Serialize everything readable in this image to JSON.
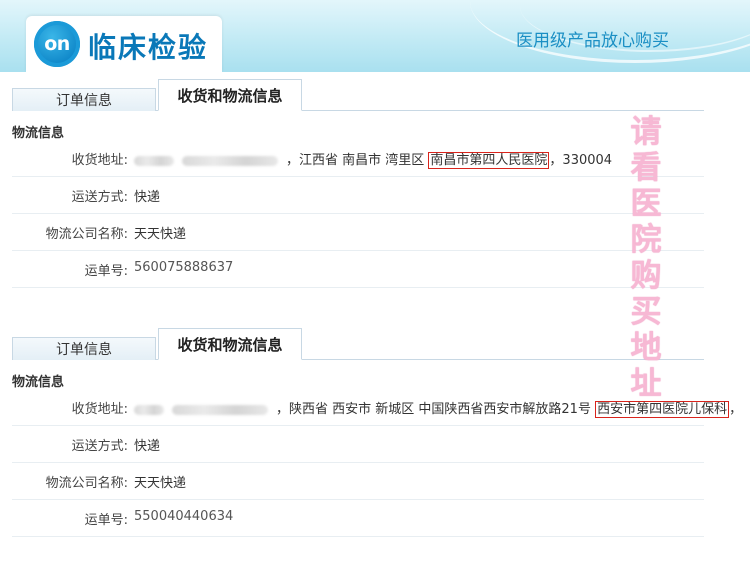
{
  "header": {
    "logo_badge": "on",
    "logo_text": "临床检验",
    "slogan": "医用级产品放心购买"
  },
  "orders": [
    {
      "tabs": {
        "inactive": "订单信息",
        "active": "收货和物流信息"
      },
      "section_title": "物流信息",
      "address_label": "收货地址:",
      "address_prefix": "，江西省 南昌市 湾里区 ",
      "address_highlight": "南昌市第四人民医院",
      "address_suffix": "，330004",
      "shipping_label": "运送方式:",
      "shipping_value": "快递",
      "courier_label": "物流公司名称:",
      "courier_value": "天天快递",
      "tracking_label": "运单号:",
      "tracking_value": "560075888637"
    },
    {
      "tabs": {
        "inactive": "订单信息",
        "active": "收货和物流信息"
      },
      "section_title": "物流信息",
      "address_label": "收货地址:",
      "address_prefix": "，陕西省 西安市 新城区 中国陕西省西安市解放路21号 ",
      "address_highlight": "西安市第四医院儿保科",
      "address_suffix": "，",
      "shipping_label": "运送方式:",
      "shipping_value": "快递",
      "courier_label": "物流公司名称:",
      "courier_value": "天天快递",
      "tracking_label": "运单号:",
      "tracking_value": "550040440634"
    }
  ],
  "overlay_note": "请看医院购买地址",
  "colors": {
    "accent": "#0a78b8",
    "highlight_border": "#d9241c",
    "overlay_text": "#f7b8d4"
  }
}
